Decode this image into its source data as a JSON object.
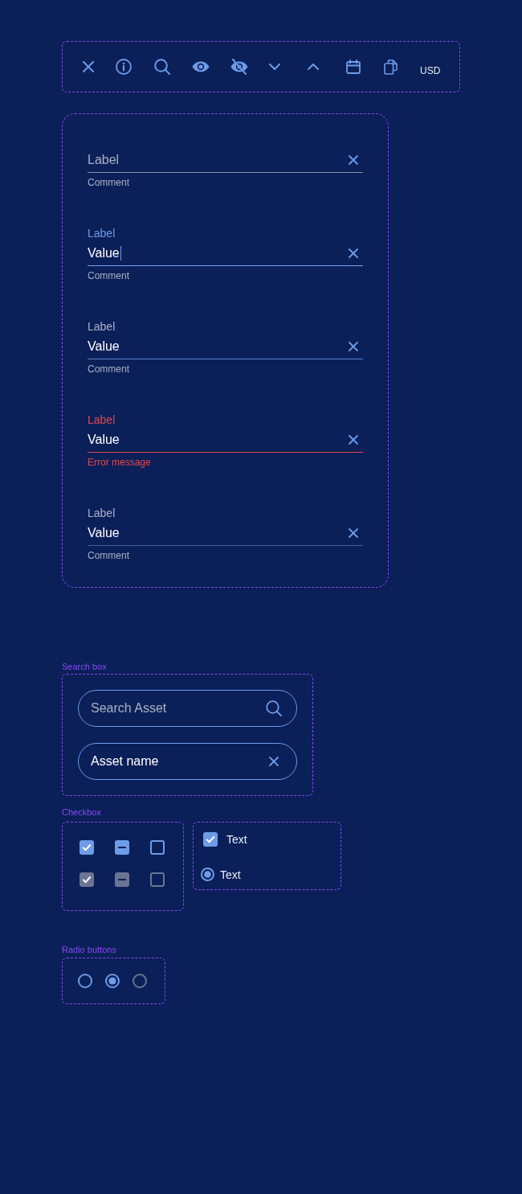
{
  "toolbar": {
    "currency": "USD"
  },
  "form": {
    "fields": [
      {
        "kind": "empty",
        "placeholder": "Label",
        "helper": "Comment"
      },
      {
        "kind": "focused",
        "label": "Label",
        "value": "Value",
        "helper": "Comment"
      },
      {
        "kind": "hover",
        "label": "Label",
        "value": "Value",
        "helper": "Comment"
      },
      {
        "kind": "error",
        "label": "Label",
        "value": "Value",
        "helper": "Error message"
      },
      {
        "kind": "filled",
        "label": "Label",
        "value": "Value",
        "helper": "Comment"
      }
    ]
  },
  "search_box": {
    "title": "Search box",
    "fields": [
      {
        "kind": "search",
        "placeholder": "Search Asset"
      },
      {
        "kind": "clear",
        "value": "Asset name"
      }
    ]
  },
  "checkbox": {
    "title": "Checkbox",
    "grid": [
      {
        "checked": true,
        "indeterminate": false,
        "disabled": false
      },
      {
        "checked": false,
        "indeterminate": true,
        "disabled": false
      },
      {
        "checked": false,
        "indeterminate": false,
        "disabled": false
      },
      {
        "checked": true,
        "indeterminate": false,
        "disabled": true
      },
      {
        "checked": false,
        "indeterminate": true,
        "disabled": true
      },
      {
        "checked": false,
        "indeterminate": false,
        "disabled": true
      }
    ],
    "examples": [
      {
        "kind": "checkbox",
        "label": "Text",
        "checked": true
      },
      {
        "kind": "radio",
        "label": "Text",
        "selected": true
      }
    ]
  },
  "radio_buttons": {
    "title": "Radio buttons",
    "items": [
      {
        "selected": false,
        "disabled": false
      },
      {
        "selected": true,
        "disabled": false
      },
      {
        "selected": false,
        "disabled": true
      }
    ]
  }
}
